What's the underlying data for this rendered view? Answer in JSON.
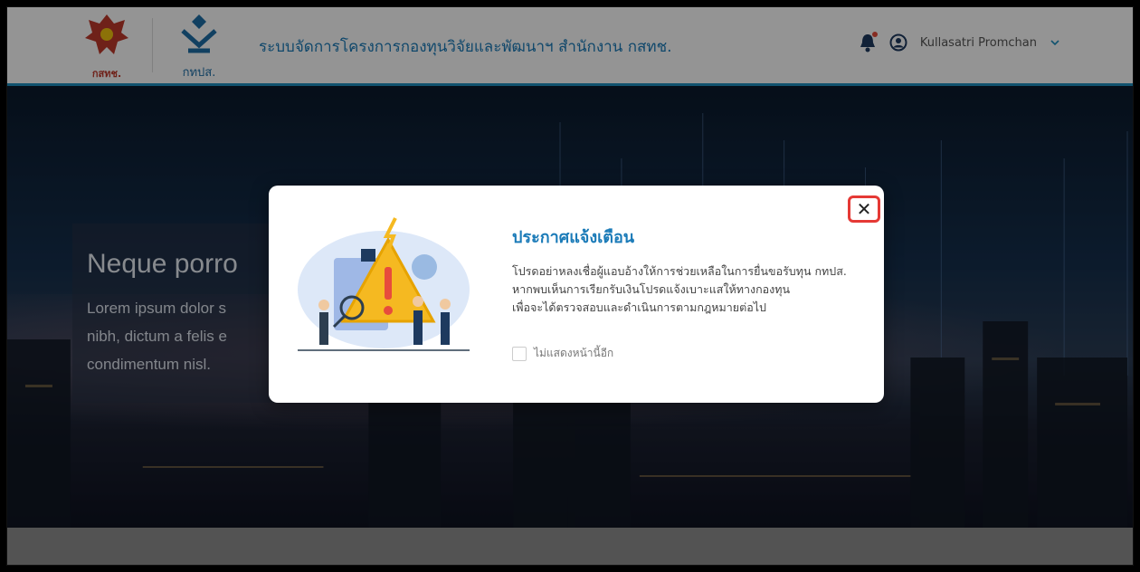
{
  "header": {
    "logo1_label": "กสทช.",
    "logo2_label": "กทปส.",
    "title": "ระบบจัดการโครงการกองทุนวิจัยและพัฒนาฯ สำนักงาน กสทช.",
    "user_name": "Kullasatri Promchan"
  },
  "hero": {
    "title": "Neque porro",
    "lines": [
      "Lorem ipsum dolor s",
      "nibh, dictum a felis e",
      "condimentum nisl."
    ]
  },
  "modal": {
    "title": "ประกาศแจ้งเตือน",
    "message_lines": [
      "โปรดอย่าหลงเชื่อผู้แอบอ้างให้การช่วยเหลือในการยื่นขอรับทุน กทปส.",
      "หากพบเห็นการเรียกรับเงินโปรดแจ้งเบาะแสให้ทางกองทุน",
      "เพื่อจะได้ตรวจสอบและดำเนินการตามกฎหมายต่อไป"
    ],
    "checkbox_label": "ไม่แสดงหน้านี้อีก",
    "close_label": "✕"
  },
  "colors": {
    "accent": "#1b7bb8",
    "alert_red": "#e53935",
    "warning_yellow": "#f5b921"
  }
}
